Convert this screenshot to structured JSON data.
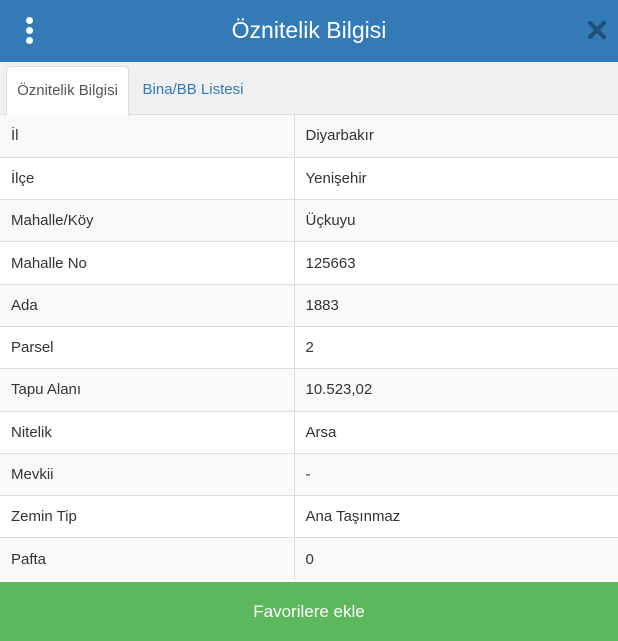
{
  "header": {
    "title": "Öznitelik Bilgisi",
    "menu_icon": "vertical-ellipsis-icon",
    "close_icon": "close-x-icon"
  },
  "tabs": [
    {
      "label": "Öznitelik Bilgisi",
      "active": true
    },
    {
      "label": "Bina/BB Listesi",
      "active": false
    }
  ],
  "attributes": [
    {
      "label": "İl",
      "value": "Diyarbakır"
    },
    {
      "label": "İlçe",
      "value": "Yenişehir"
    },
    {
      "label": "Mahalle/Köy",
      "value": "Üçkuyu"
    },
    {
      "label": "Mahalle No",
      "value": "125663"
    },
    {
      "label": "Ada",
      "value": "1883"
    },
    {
      "label": "Parsel",
      "value": "2"
    },
    {
      "label": "Tapu Alanı",
      "value": "10.523,02"
    },
    {
      "label": "Nitelik",
      "value": "Arsa"
    },
    {
      "label": "Mevkii",
      "value": "-"
    },
    {
      "label": "Zemin Tip",
      "value": "Ana Taşınmaz"
    },
    {
      "label": "Pafta",
      "value": "0"
    }
  ],
  "footer": {
    "favorite_label": "Favorilere ekle"
  },
  "colors": {
    "header_bg": "#337ab7",
    "tab_link": "#337ab7",
    "favorite_bg": "#5cb85c",
    "close_icon": "#1f4f7a"
  }
}
